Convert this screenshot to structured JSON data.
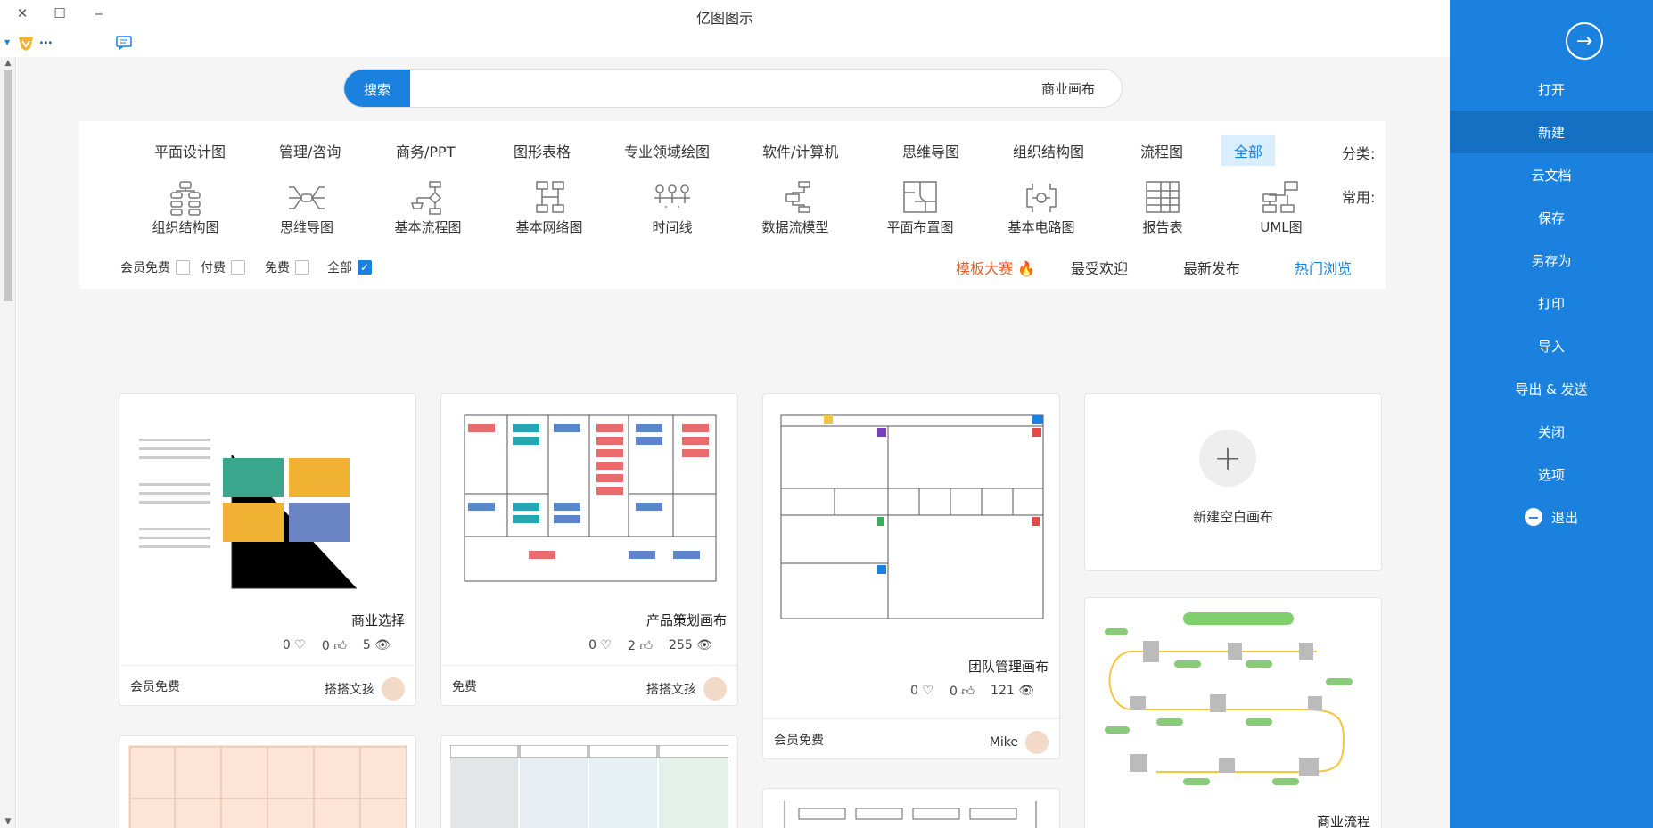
{
  "window": {
    "title": "亿图图示",
    "close": "✕",
    "maximize": "☐",
    "minimize": "‒"
  },
  "toolbar": {
    "user_label": "..."
  },
  "search": {
    "button": "搜索",
    "value": "商业画布"
  },
  "categories": {
    "label": "分类:",
    "items": [
      "全部",
      "流程图",
      "组织结构图",
      "思维导图",
      "软件/计算机",
      "专业领域绘图",
      "图形表格",
      "商务/PPT",
      "管理/咨询",
      "平面设计图"
    ]
  },
  "common": {
    "label": "常用:",
    "items": [
      {
        "name": "UML图",
        "icon": "uml-icon"
      },
      {
        "name": "报告表",
        "icon": "report-icon"
      },
      {
        "name": "基本电路图",
        "icon": "circuit-icon"
      },
      {
        "name": "平面布置图",
        "icon": "floorplan-icon"
      },
      {
        "name": "数据流模型",
        "icon": "dataflow-icon"
      },
      {
        "name": "时间线",
        "icon": "timeline-icon"
      },
      {
        "name": "基本网络图",
        "icon": "network-icon"
      },
      {
        "name": "基本流程图",
        "icon": "flowchart-icon"
      },
      {
        "name": "思维导图",
        "icon": "mindmap-icon"
      },
      {
        "name": "组织结构图",
        "icon": "orgchart-icon"
      }
    ]
  },
  "tabs": [
    "热门浏览",
    "最新发布",
    "最受欢迎",
    "模板大赛"
  ],
  "filters": [
    {
      "label": "全部",
      "checked": true
    },
    {
      "label": "免费",
      "checked": false
    },
    {
      "label": "付费",
      "checked": false
    },
    {
      "label": "会员免费",
      "checked": false
    }
  ],
  "new_canvas": {
    "label": "新建空白画布"
  },
  "cards": [
    {
      "title": "团队管理画布",
      "views": "121",
      "likes": "0",
      "favs": "0",
      "author": "Mike",
      "price": "会员免费"
    },
    {
      "title": "产品策划画布",
      "views": "255",
      "likes": "2",
      "favs": "0",
      "author": "搭搭文孩",
      "price": "免费"
    },
    {
      "title": "商业选择",
      "views": "5",
      "likes": "0",
      "favs": "0",
      "author": "搭搭文孩",
      "price": "会员免费"
    },
    {
      "title": "商业流程"
    }
  ],
  "sidebar": {
    "back_icon": "arrow-right-icon",
    "items": [
      "打开",
      "新建",
      "云文档",
      "保存",
      "另存为",
      "打印",
      "导入",
      "导出 & 发送",
      "关闭",
      "选项",
      "退出"
    ]
  },
  "colors": {
    "accent": "#1a82de",
    "sidebar": "#1a82de",
    "contest": "#f05a28"
  }
}
